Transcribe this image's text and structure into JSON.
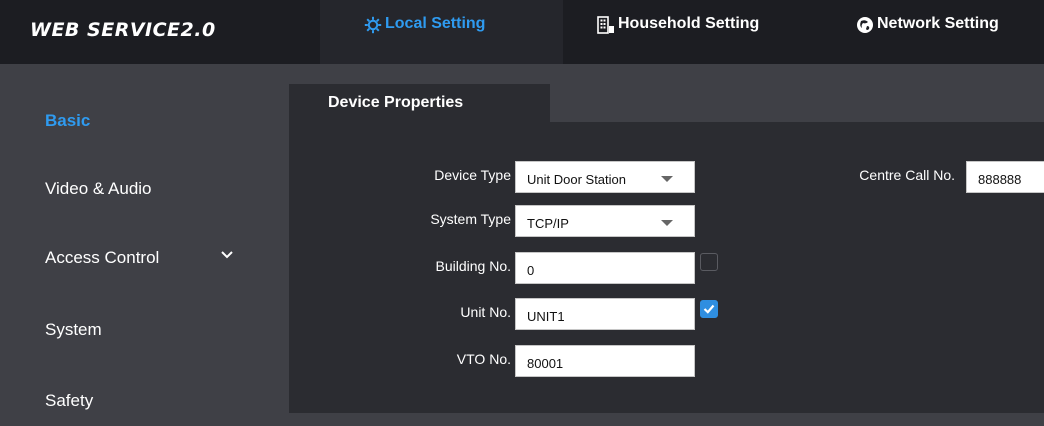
{
  "app": {
    "logo_text": "WEB SERVICE2.0"
  },
  "nav": {
    "tabs": [
      {
        "label": "Local Setting",
        "icon": "gear-icon",
        "active": true
      },
      {
        "label": "Household Setting",
        "icon": "building-icon",
        "active": false
      },
      {
        "label": "Network Setting",
        "icon": "globe-icon",
        "active": false
      }
    ]
  },
  "sidebar": {
    "items": [
      {
        "label": "Basic",
        "active": true
      },
      {
        "label": "Video & Audio",
        "active": false
      },
      {
        "label": "Access Control",
        "active": false,
        "expandable": true
      },
      {
        "label": "System",
        "active": false
      },
      {
        "label": "Safety",
        "active": false
      }
    ]
  },
  "panel": {
    "tab_label": "Device Properties",
    "fields": {
      "device_type": {
        "label": "Device Type",
        "value": "Unit Door Station"
      },
      "system_type": {
        "label": "System Type",
        "value": "TCP/IP"
      },
      "building_no": {
        "label": "Building No.",
        "value": "0",
        "checked": false
      },
      "unit_no": {
        "label": "Unit No.",
        "value": "UNIT1",
        "checked": true
      },
      "vto_no": {
        "label": "VTO No.",
        "value": "80001"
      },
      "centre_call_no": {
        "label": "Centre Call No.",
        "value": "888888"
      }
    }
  },
  "colors": {
    "accent": "#2f9bf0",
    "topbar_bg": "#1c1d22",
    "page_bg": "#3f4046",
    "panel_bg": "#2b2c31",
    "checkbox_checked": "#2f8ee0"
  }
}
